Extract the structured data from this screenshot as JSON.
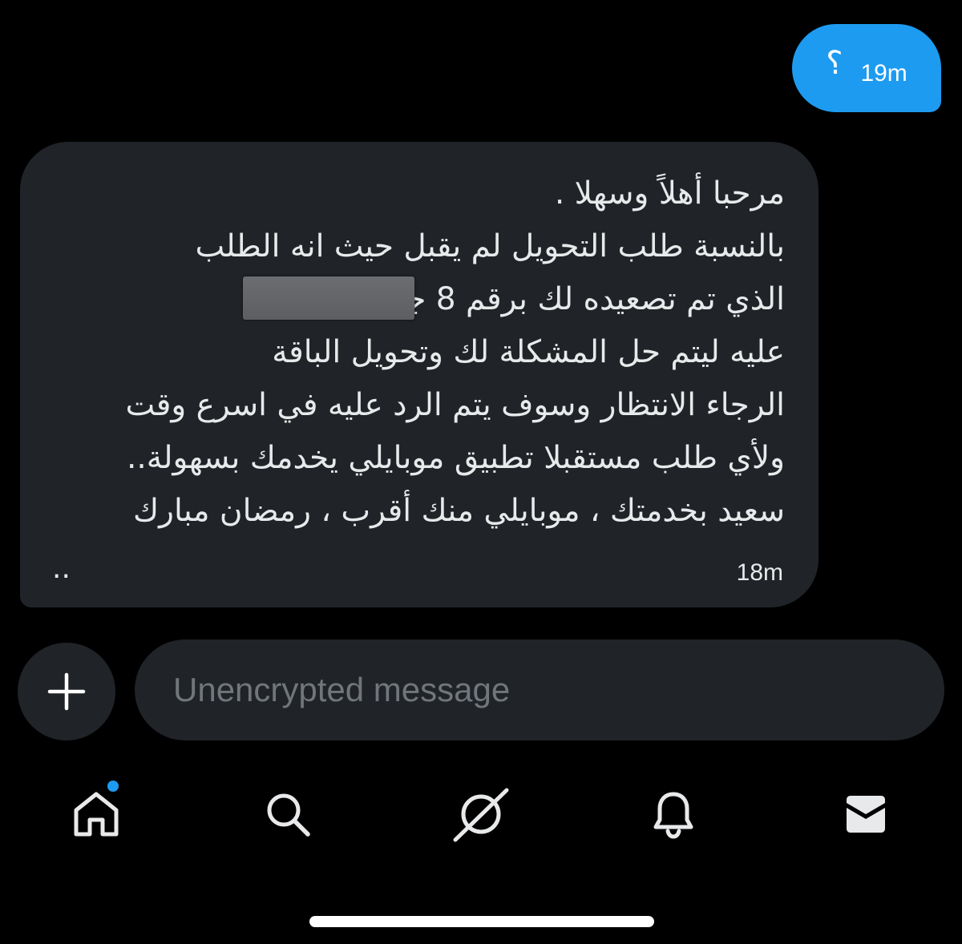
{
  "sent_message": {
    "text": "؟",
    "time": "19m"
  },
  "received_message": {
    "lines": [
      "مرحبا أهلاً وسهلا .",
      "بالنسبة طلب التحويل لم يقبل حيث انه الطلب",
      "الذي تم تصعيده لك برقم 8 جاري العمل",
      "عليه ليتم حل المشكلة لك وتحويل الباقة",
      "الرجاء الانتظار وسوف يتم الرد عليه في اسرع وقت",
      "ولأي طلب مستقبلا تطبيق موبايلي يخدمك بسهولة..",
      "سعيد بخدمتك ، موبايلي منك أقرب ،  رمضان مبارك"
    ],
    "trailing": "..",
    "time": "18m"
  },
  "composer": {
    "placeholder": "Unencrypted message",
    "add_icon": "plus-icon"
  },
  "nav": {
    "items": [
      {
        "icon": "home-icon",
        "label": "Home",
        "notification_dot": true
      },
      {
        "icon": "search-icon",
        "label": "Search"
      },
      {
        "icon": "grok-icon",
        "label": "Grok"
      },
      {
        "icon": "bell-icon",
        "label": "Notifications"
      },
      {
        "icon": "mail-icon",
        "label": "Messages",
        "active": true
      }
    ]
  },
  "colors": {
    "background": "#000000",
    "accent": "#1d9bf0",
    "bubble": "#202327",
    "text": "#e7e9ea",
    "placeholder": "#71767b"
  }
}
